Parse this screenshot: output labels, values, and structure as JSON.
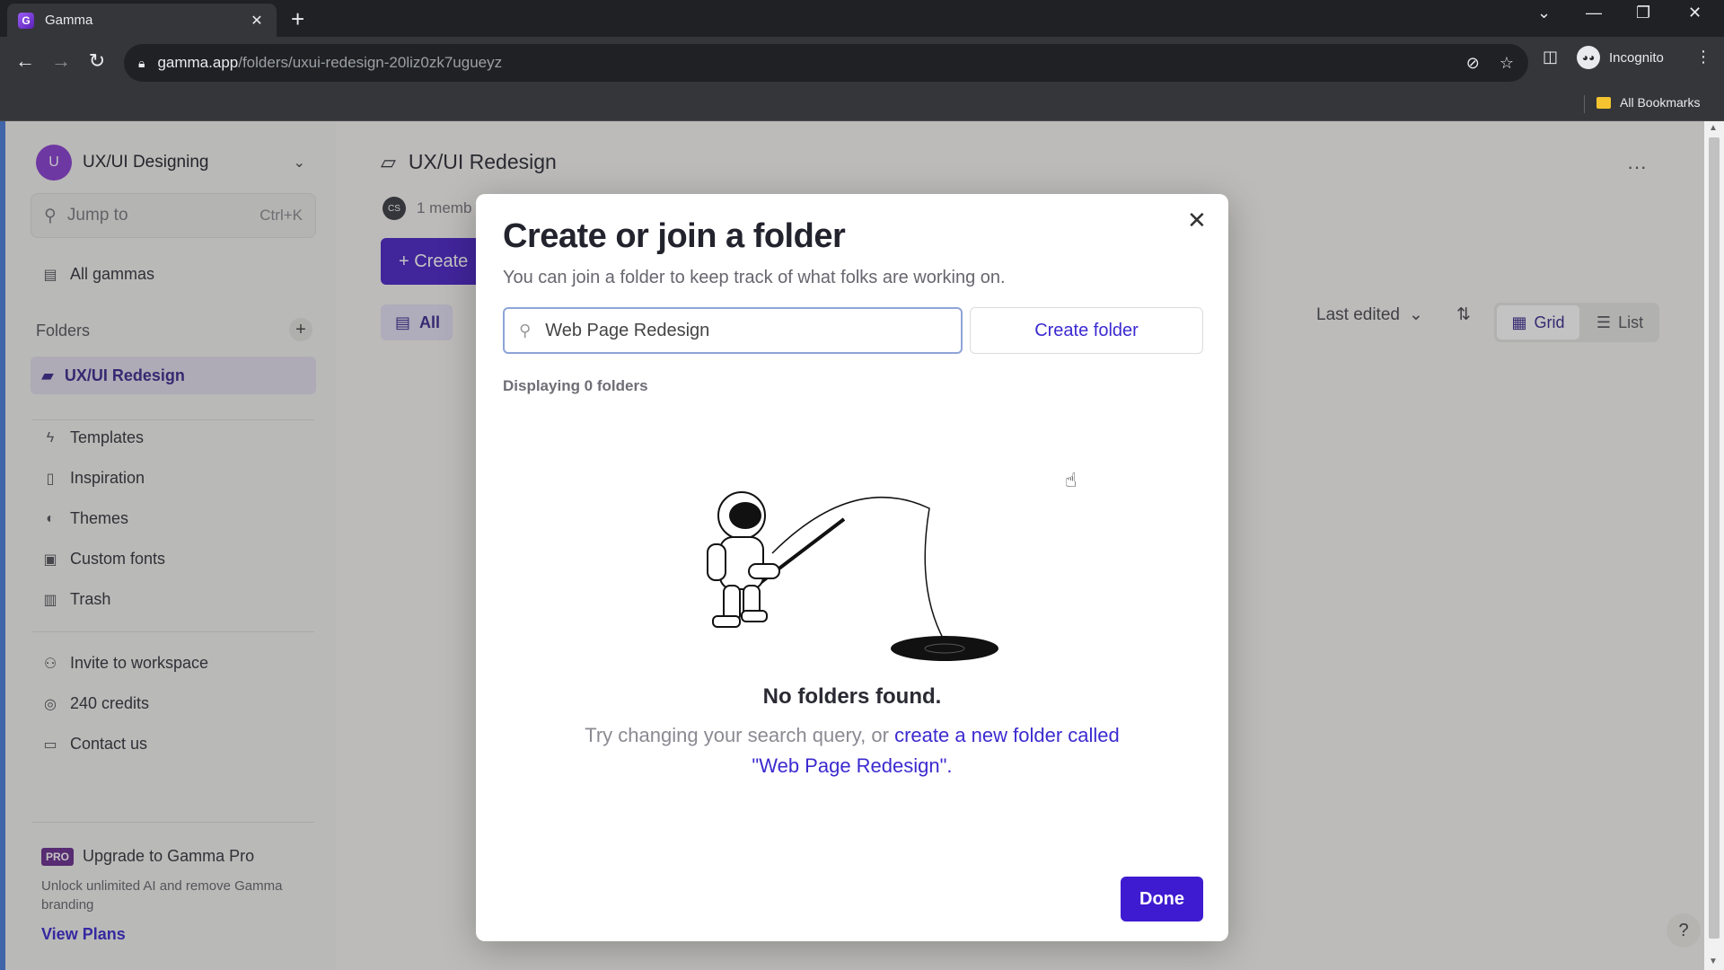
{
  "browser": {
    "tab_title": "Gamma",
    "tab_close": "✕",
    "new_tab": "+",
    "url_domain": "gamma.app",
    "url_path": "/folders/uxui-redesign-20liz0zk7ugueyz",
    "profile_label": "Incognito",
    "bookmarks_label": "All Bookmarks"
  },
  "sidebar": {
    "workspace_initial": "U",
    "workspace_name": "UX/UI Designing",
    "jump_placeholder": "Jump to",
    "jump_shortcut": "Ctrl+K",
    "all_gammas": "All gammas",
    "folders_heading": "Folders",
    "folders_add": "+",
    "active_folder": "UX/UI Redesign",
    "nav": [
      {
        "label": "Templates",
        "icon": "bolt-icon"
      },
      {
        "label": "Inspiration",
        "icon": "book-icon"
      },
      {
        "label": "Themes",
        "icon": "palette-icon"
      },
      {
        "label": "Custom fonts",
        "icon": "font-icon"
      },
      {
        "label": "Trash",
        "icon": "trash-icon"
      }
    ],
    "secondary": [
      {
        "label": "Invite to workspace",
        "icon": "add-user-icon"
      },
      {
        "label": "240 credits",
        "icon": "coins-icon"
      },
      {
        "label": "Contact us",
        "icon": "chat-icon"
      }
    ],
    "pro_badge": "PRO",
    "pro_title": "Upgrade to Gamma Pro",
    "pro_desc": "Unlock unlimited AI and remove Gamma branding",
    "pro_link": "View Plans"
  },
  "main": {
    "title": "UX/UI Redesign",
    "member_initials": "CS",
    "members_text": "1 memb",
    "create_label": "+ Create",
    "filter_all": "All",
    "sort_label": "Last edited",
    "view_grid": "Grid",
    "view_list": "List",
    "more": "···",
    "help": "?"
  },
  "modal": {
    "title": "Create or join a folder",
    "subtitle": "You can join a folder to keep track of what folks are working on.",
    "search_value": "Web Page Redesign",
    "create_button": "Create folder",
    "count_text": "Displaying 0 folders",
    "empty_title": "No folders found.",
    "hint_prefix": "Try changing your search query, or ",
    "hint_link": "create a new folder called \"Web Page Redesign\".",
    "done_button": "Done",
    "close": "✕"
  },
  "colors": {
    "accent": "#4b24c8",
    "link": "#3b2ad0",
    "active_folder_bg": "#e2deee"
  }
}
